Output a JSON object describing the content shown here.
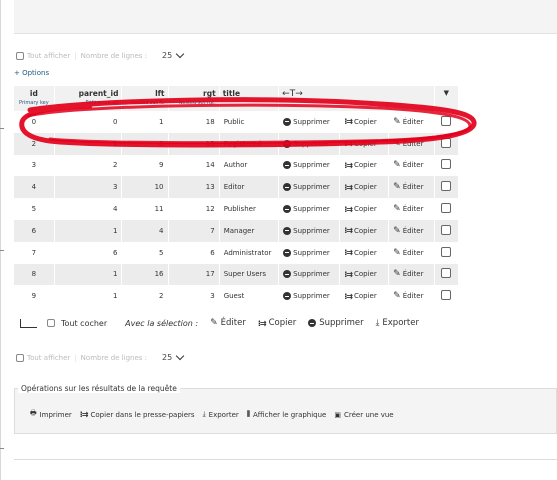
{
  "nav": {
    "show_all": "Tout afficher",
    "rows_label": "Nombre de lignes :",
    "rows_value": "25"
  },
  "options_link": "+ Options",
  "table": {
    "headers": [
      {
        "label": "id",
        "sub": "Primary key"
      },
      {
        "label": "parent_id",
        "sub": "Référence au"
      },
      {
        "label": "lft",
        "sub": "Nested set ft."
      },
      {
        "label": "rgt",
        "sub": "Nested set rgt."
      },
      {
        "label": "title",
        "sub": ""
      }
    ],
    "arrows": "←T→",
    "rows": [
      {
        "id": "0",
        "parent_id": "0",
        "lft": "1",
        "rgt": "18",
        "title": "Public"
      },
      {
        "id": "2",
        "parent_id": "1",
        "lft": "8",
        "rgt": "15",
        "title": "Registered"
      },
      {
        "id": "3",
        "parent_id": "2",
        "lft": "9",
        "rgt": "14",
        "title": "Author"
      },
      {
        "id": "4",
        "parent_id": "3",
        "lft": "10",
        "rgt": "13",
        "title": "Editor"
      },
      {
        "id": "5",
        "parent_id": "4",
        "lft": "11",
        "rgt": "12",
        "title": "Publisher"
      },
      {
        "id": "6",
        "parent_id": "1",
        "lft": "4",
        "rgt": "7",
        "title": "Manager"
      },
      {
        "id": "7",
        "parent_id": "6",
        "lft": "5",
        "rgt": "6",
        "title": "Administrator"
      },
      {
        "id": "8",
        "parent_id": "1",
        "lft": "16",
        "rgt": "17",
        "title": "Super Users"
      },
      {
        "id": "9",
        "parent_id": "1",
        "lft": "2",
        "rgt": "3",
        "title": "Guest"
      }
    ],
    "actions": {
      "delete": "Supprimer",
      "copy": "Copier",
      "edit": "Éditer"
    }
  },
  "bulk": {
    "check_all": "Tout cocher",
    "with_selection": "Avec la sélection :",
    "edit": "Éditer",
    "copy": "Copier",
    "delete": "Supprimer",
    "export": "Exporter"
  },
  "ops": {
    "title": "Opérations sur les résultats de la requête",
    "print": "Imprimer",
    "copy_clipboard": "Copier dans le presse-papiers",
    "export": "Exporter",
    "chart": "Afficher le graphique",
    "create_view": "Créer une vue"
  },
  "annotation_color": "#e3001b"
}
